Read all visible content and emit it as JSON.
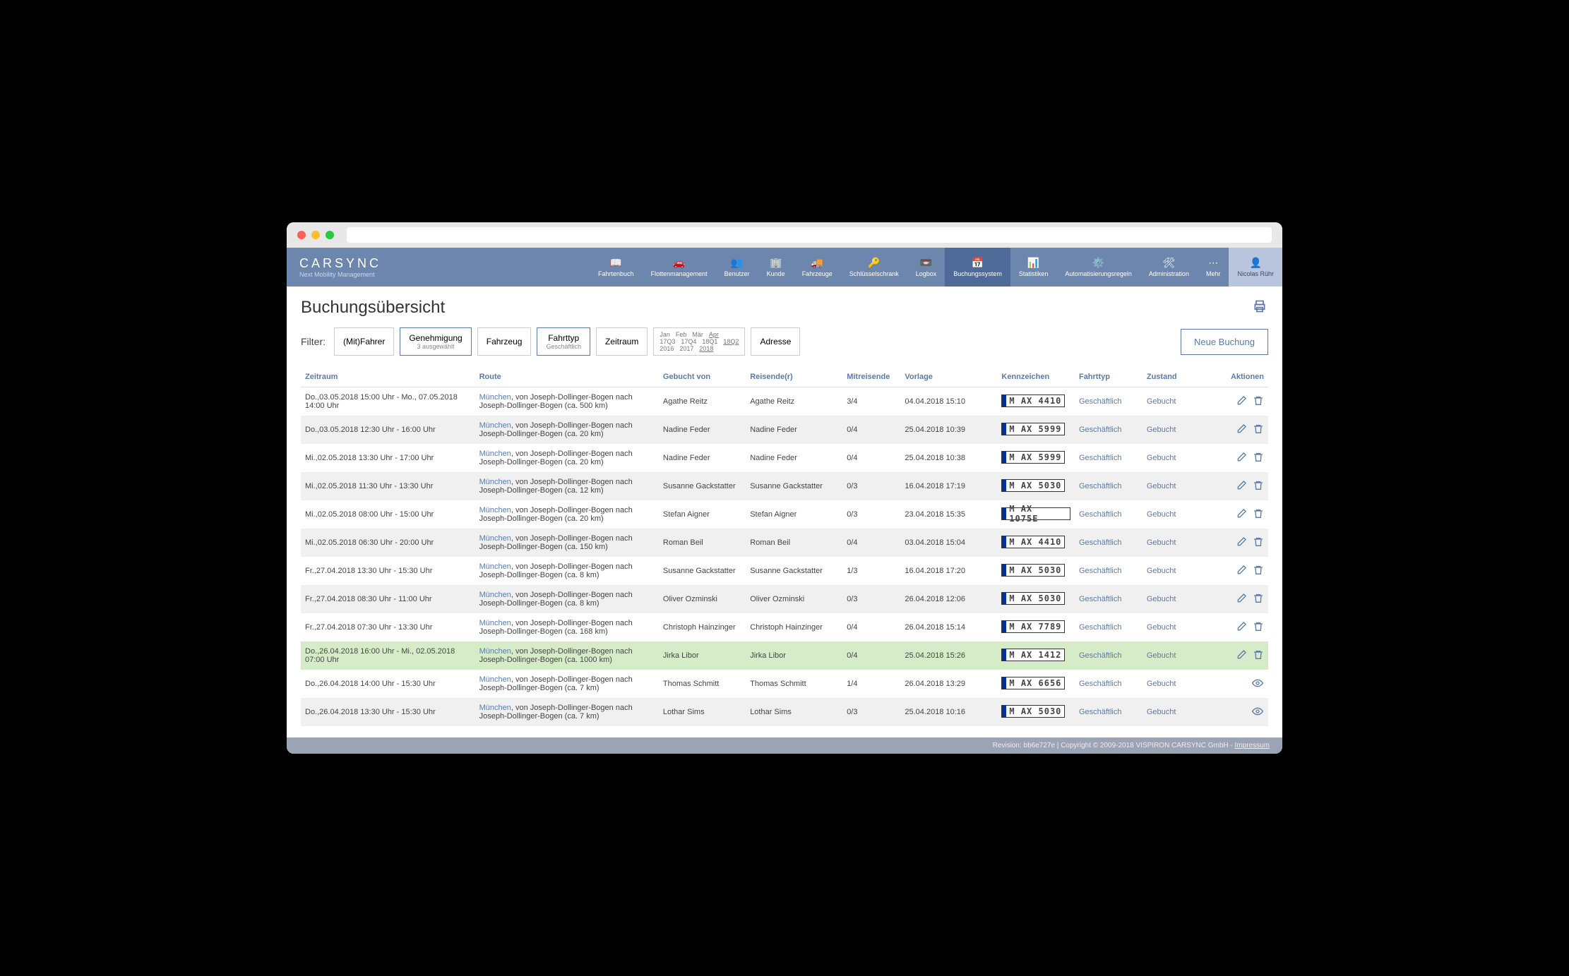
{
  "brand": {
    "name": "CARSYNC",
    "sub": "Next Mobility Management"
  },
  "nav": [
    {
      "label": "Fahrtenbuch",
      "icon": "📖"
    },
    {
      "label": "Flottenmanagement",
      "icon": "🚗"
    },
    {
      "label": "Benutzer",
      "icon": "👥"
    },
    {
      "label": "Kunde",
      "icon": "🏢"
    },
    {
      "label": "Fahrzeuge",
      "icon": "🚚"
    },
    {
      "label": "Schlüsselschrank",
      "icon": "🔑"
    },
    {
      "label": "Logbox",
      "icon": "📼"
    },
    {
      "label": "Buchungssystem",
      "icon": "📅",
      "active": true
    },
    {
      "label": "Statistiken",
      "icon": "📊"
    },
    {
      "label": "Automatisierungsregeln",
      "icon": "⚙️"
    },
    {
      "label": "Administration",
      "icon": "🛠"
    },
    {
      "label": "Mehr",
      "icon": "⋯"
    }
  ],
  "user_name": "Nicolas Rühr",
  "page_title": "Buchungsübersicht",
  "filter": {
    "label": "Filter:",
    "mitfahrer": "(Mit)Fahrer",
    "genehmigung": {
      "label": "Genehmigung",
      "sub": "3 ausgewählt"
    },
    "fahrzeug": "Fahrzeug",
    "fahrttyp": {
      "label": "Fahrttyp",
      "sub": "Geschäftlich"
    },
    "zeitraum": "Zeitraum",
    "timegrid": {
      "months": [
        "Jan",
        "Feb",
        "Mär",
        "Apr"
      ],
      "quarters": [
        "17Q3",
        "17Q4",
        "18Q1",
        "18Q2"
      ],
      "years": [
        "2016",
        "2017",
        "2018"
      ]
    },
    "adresse": "Adresse",
    "new_btn": "Neue Buchung"
  },
  "columns": {
    "zeitraum": "Zeitraum",
    "route": "Route",
    "von": "Gebucht von",
    "reisender": "Reisende(r)",
    "mit": "Mitreisende",
    "vorlage": "Vorlage",
    "kenn": "Kennzeichen",
    "typ": "Fahrttyp",
    "zustand": "Zustand",
    "aktionen": "Aktionen"
  },
  "rows": [
    {
      "zeit": "Do.,03.05.2018 15:00 Uhr - Mo., 07.05.2018 14:00 Uhr",
      "city": "München",
      "route": ", von Joseph-Dollinger-Bogen nach Joseph-Dollinger-Bogen (ca. 500 km)",
      "von": "Agathe Reitz",
      "reis": "Agathe Reitz",
      "mit": "3/4",
      "vor": "04.04.2018 15:10",
      "kenn": "M  AX 4410",
      "typ": "Geschäftlich",
      "zust": "Gebucht",
      "mode": "edit"
    },
    {
      "zeit": "Do.,03.05.2018 12:30 Uhr - 16:00 Uhr",
      "city": "München",
      "route": ", von Joseph-Dollinger-Bogen nach Joseph-Dollinger-Bogen (ca. 20 km)",
      "von": "Nadine Feder",
      "reis": "Nadine Feder",
      "mit": "0/4",
      "vor": "25.04.2018 10:39",
      "kenn": "M  AX 5999",
      "typ": "Geschäftlich",
      "zust": "Gebucht",
      "mode": "edit"
    },
    {
      "zeit": "Mi.,02.05.2018 13:30 Uhr - 17:00 Uhr",
      "city": "München",
      "route": ", von Joseph-Dollinger-Bogen nach Joseph-Dollinger-Bogen (ca. 20 km)",
      "von": "Nadine Feder",
      "reis": "Nadine Feder",
      "mit": "0/4",
      "vor": "25.04.2018 10:38",
      "kenn": "M  AX 5999",
      "typ": "Geschäftlich",
      "zust": "Gebucht",
      "mode": "edit"
    },
    {
      "zeit": "Mi.,02.05.2018 11:30 Uhr - 13:30 Uhr",
      "city": "München",
      "route": ", von Joseph-Dollinger-Bogen nach Joseph-Dollinger-Bogen (ca. 12 km)",
      "von": "Susanne Gackstatter",
      "reis": "Susanne Gackstatter",
      "mit": "0/3",
      "vor": "16.04.2018 17:19",
      "kenn": "M  AX 5030",
      "typ": "Geschäftlich",
      "zust": "Gebucht",
      "mode": "edit"
    },
    {
      "zeit": "Mi.,02.05.2018 08:00 Uhr - 15:00 Uhr",
      "city": "München",
      "route": ", von Joseph-Dollinger-Bogen nach Joseph-Dollinger-Bogen (ca. 20 km)",
      "von": "Stefan Aigner",
      "reis": "Stefan Aigner",
      "mit": "0/3",
      "vor": "23.04.2018 15:35",
      "kenn": "M  AX 1075E",
      "typ": "Geschäftlich",
      "zust": "Gebucht",
      "mode": "edit"
    },
    {
      "zeit": "Mi.,02.05.2018 06:30 Uhr - 20:00 Uhr",
      "city": "München",
      "route": ", von Joseph-Dollinger-Bogen nach Joseph-Dollinger-Bogen (ca. 150 km)",
      "von": "Roman Beil",
      "reis": "Roman Beil",
      "mit": "0/4",
      "vor": "03.04.2018 15:04",
      "kenn": "M  AX 4410",
      "typ": "Geschäftlich",
      "zust": "Gebucht",
      "mode": "edit"
    },
    {
      "zeit": "Fr.,27.04.2018 13:30 Uhr - 15:30 Uhr",
      "city": "München",
      "route": ", von Joseph-Dollinger-Bogen nach Joseph-Dollinger-Bogen (ca. 8 km)",
      "von": "Susanne Gackstatter",
      "reis": "Susanne Gackstatter",
      "mit": "1/3",
      "vor": "16.04.2018 17:20",
      "kenn": "M  AX 5030",
      "typ": "Geschäftlich",
      "zust": "Gebucht",
      "mode": "edit"
    },
    {
      "zeit": "Fr.,27.04.2018 08:30 Uhr - 11:00 Uhr",
      "city": "München",
      "route": ", von Joseph-Dollinger-Bogen nach Joseph-Dollinger-Bogen (ca. 8 km)",
      "von": "Oliver Ozminski",
      "reis": "Oliver Ozminski",
      "mit": "0/3",
      "vor": "26.04.2018 12:06",
      "kenn": "M  AX 5030",
      "typ": "Geschäftlich",
      "zust": "Gebucht",
      "mode": "edit"
    },
    {
      "zeit": "Fr.,27.04.2018 07:30 Uhr - 13:30 Uhr",
      "city": "München",
      "route": ", von Joseph-Dollinger-Bogen nach Joseph-Dollinger-Bogen (ca. 168 km)",
      "von": "Christoph Hainzinger",
      "reis": "Christoph Hainzinger",
      "mit": "0/4",
      "vor": "26.04.2018 15:14",
      "kenn": "M  AX 7789",
      "typ": "Geschäftlich",
      "zust": "Gebucht",
      "mode": "edit"
    },
    {
      "zeit": "Do.,26.04.2018 16:00 Uhr - Mi., 02.05.2018 07:00 Uhr",
      "city": "München",
      "route": ", von Joseph-Dollinger-Bogen nach Joseph-Dollinger-Bogen (ca. 1000 km)",
      "von": "Jirka Libor",
      "reis": "Jirka Libor",
      "mit": "0/4",
      "vor": "25.04.2018 15:26",
      "kenn": "M  AX 1412",
      "typ": "Geschäftlich",
      "zust": "Gebucht",
      "mode": "edit",
      "hl": true
    },
    {
      "zeit": "Do.,26.04.2018 14:00 Uhr - 15:30 Uhr",
      "city": "München",
      "route": ", von Joseph-Dollinger-Bogen nach Joseph-Dollinger-Bogen (ca. 7 km)",
      "von": "Thomas Schmitt",
      "reis": "Thomas Schmitt",
      "mit": "1/4",
      "vor": "26.04.2018 13:29",
      "kenn": "M  AX 6656",
      "typ": "Geschäftlich",
      "zust": "Gebucht",
      "mode": "view"
    },
    {
      "zeit": "Do.,26.04.2018 13:30 Uhr - 15:30 Uhr",
      "city": "München",
      "route": ", von Joseph-Dollinger-Bogen nach Joseph-Dollinger-Bogen (ca. 7 km)",
      "von": "Lothar Sims",
      "reis": "Lothar Sims",
      "mit": "0/3",
      "vor": "25.04.2018 10:16",
      "kenn": "M  AX 5030",
      "typ": "Geschäftlich",
      "zust": "Gebucht",
      "mode": "view"
    }
  ],
  "footer": {
    "text": "Revision: bb6e727e | Copyright © 2009-2018 VISPIRON CARSYNC GmbH - ",
    "link": "Impressum"
  }
}
